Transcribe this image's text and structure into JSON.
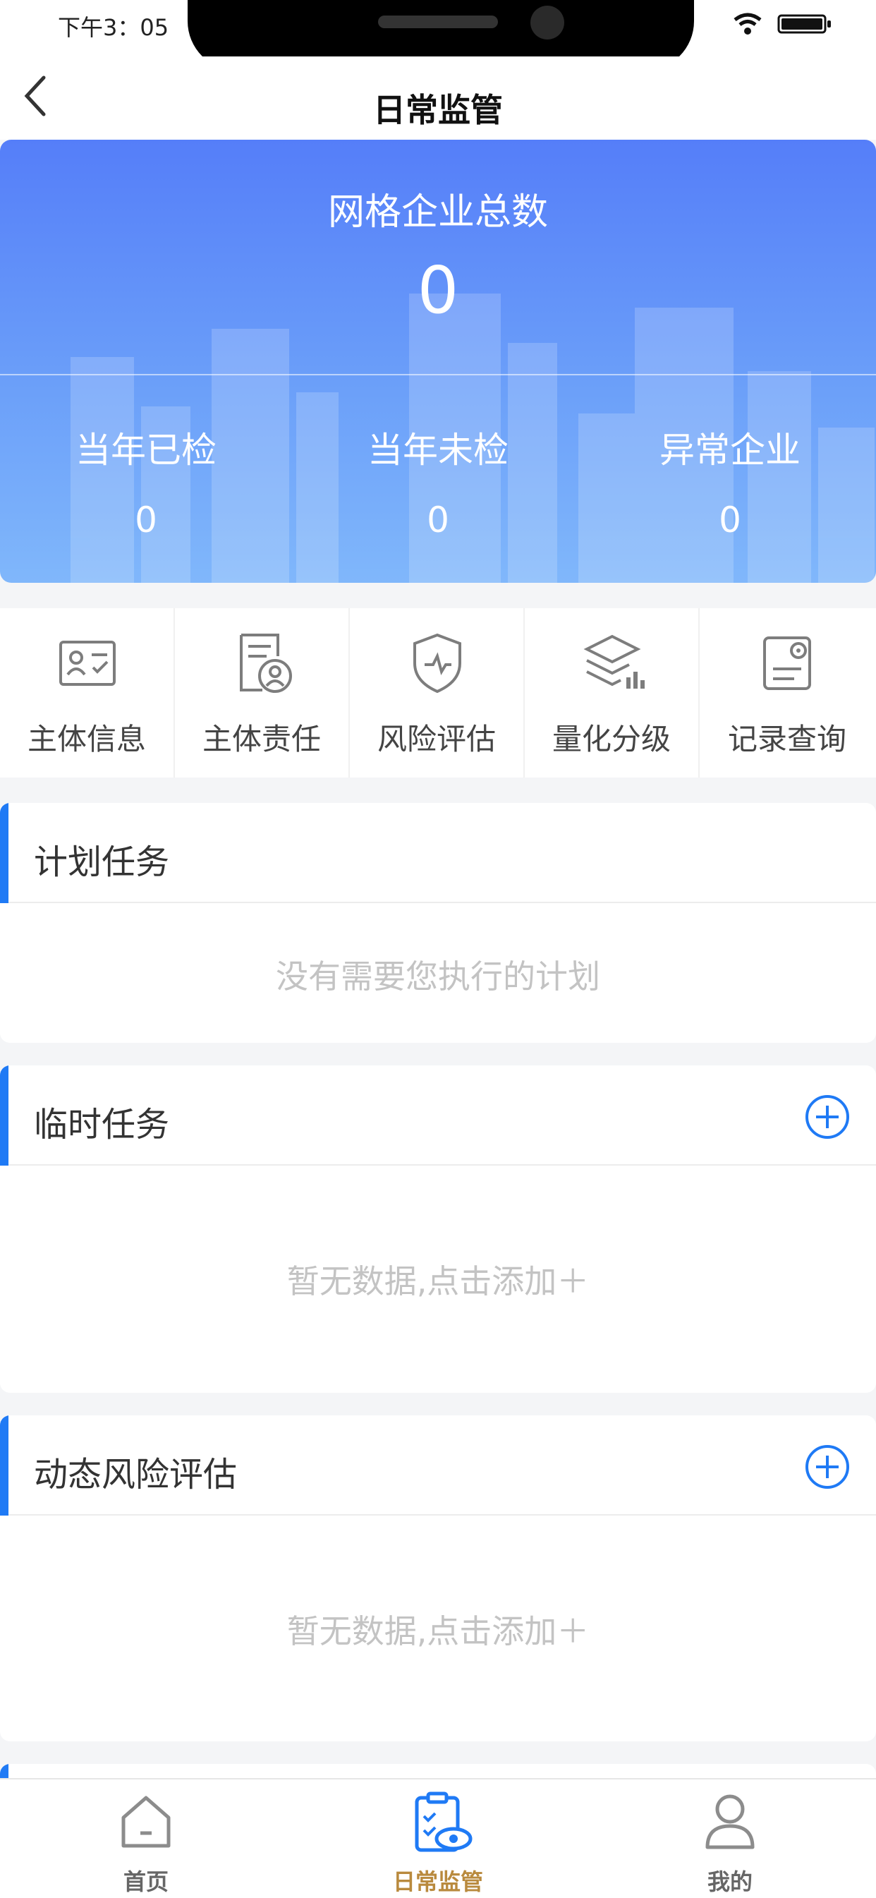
{
  "status_bar": {
    "time": "下午3：05"
  },
  "header": {
    "title": "日常监管"
  },
  "summary": {
    "total_label": "网格企业总数",
    "total_value": "0",
    "stats": [
      {
        "label": "当年已检",
        "value": "0"
      },
      {
        "label": "当年未检",
        "value": "0"
      },
      {
        "label": "异常企业",
        "value": "0"
      }
    ]
  },
  "quick_actions": [
    {
      "label": "主体信息",
      "icon": "id-card-icon"
    },
    {
      "label": "主体责任",
      "icon": "person-document-icon"
    },
    {
      "label": "风险评估",
      "icon": "shield-pulse-icon"
    },
    {
      "label": "量化分级",
      "icon": "layers-chart-icon"
    },
    {
      "label": "记录查询",
      "icon": "record-search-icon"
    }
  ],
  "sections": {
    "plan": {
      "title": "计划任务",
      "empty_text": "没有需要您执行的计划"
    },
    "temp": {
      "title": "临时任务",
      "empty_text": "暂无数据,点击添加＋"
    },
    "risk": {
      "title": "动态风险评估",
      "empty_text": "暂无数据,点击添加＋"
    }
  },
  "tabbar": {
    "items": [
      {
        "label": "首页",
        "icon": "home-icon",
        "active": false
      },
      {
        "label": "日常监管",
        "icon": "clipboard-eye-icon",
        "active": true
      },
      {
        "label": "我的",
        "icon": "user-icon",
        "active": false
      }
    ]
  },
  "colors": {
    "accent": "#1f7af5",
    "card_gradient_top": "#557ef9",
    "card_gradient_bottom": "#80b7fb",
    "active_tab": "#b98a3e"
  }
}
